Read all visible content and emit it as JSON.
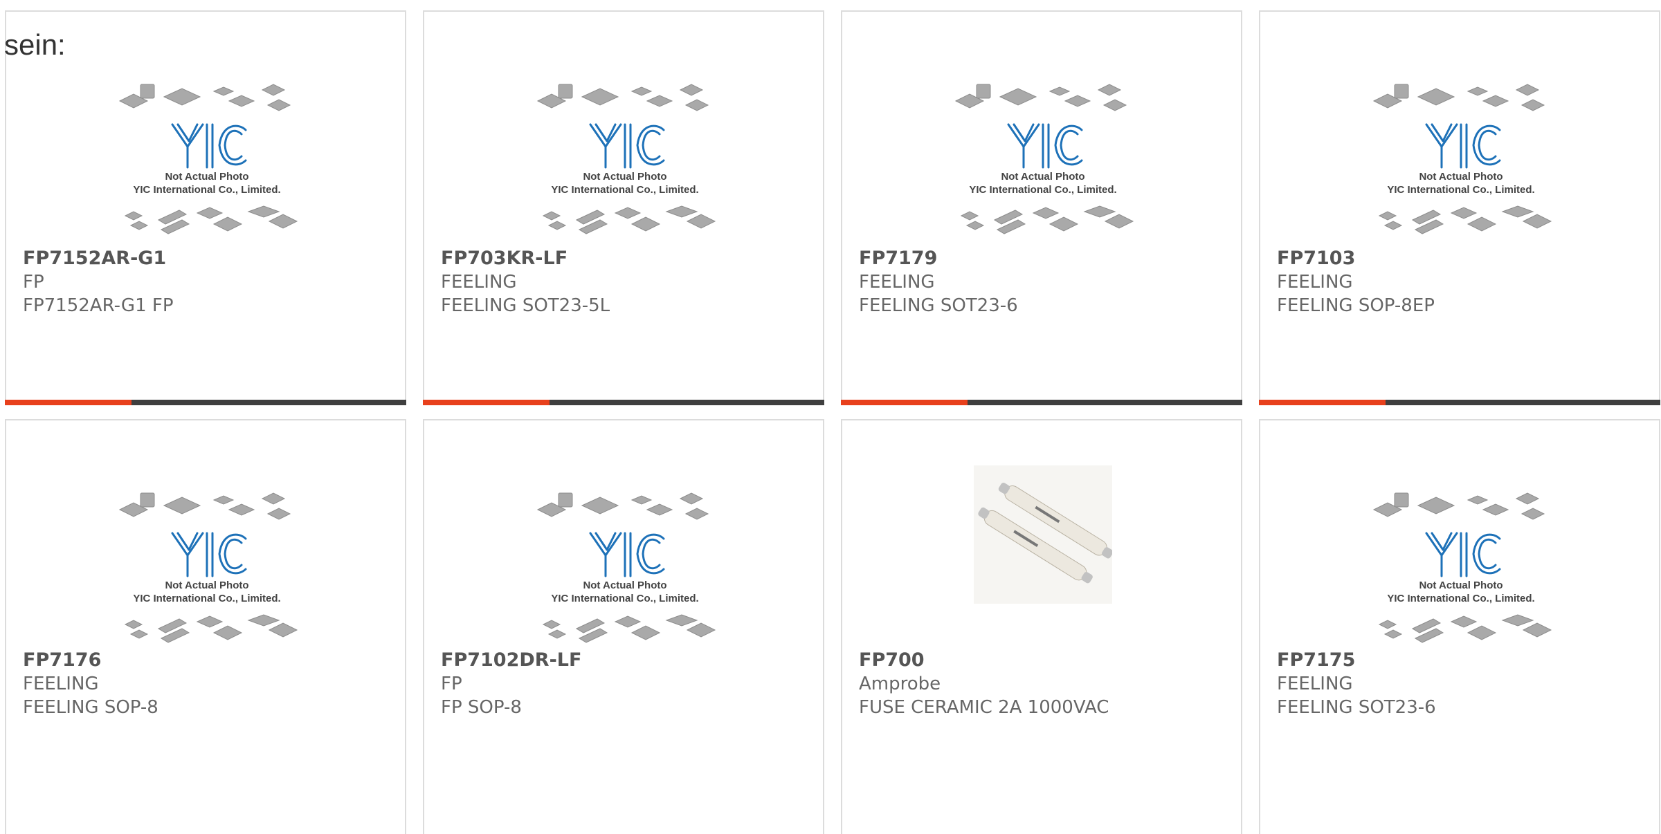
{
  "intro_text": "sein:",
  "colors": {
    "accent": "#e8401c",
    "bar_dark": "#3f3f3f",
    "logo_blue": "#1d71b8"
  },
  "placeholder": {
    "line1": "Not Actual Photo",
    "line2": "YIC International Co., Limited."
  },
  "products": [
    {
      "name": "FP7152AR-G1",
      "brand": "FP",
      "desc": "FP7152AR-G1 FP",
      "image": "placeholder-logo"
    },
    {
      "name": "FP703KR-LF",
      "brand": "FEELING",
      "desc": "FEELING SOT23-5L",
      "image": "placeholder-logo"
    },
    {
      "name": "FP7179",
      "brand": "FEELING",
      "desc": "FEELING SOT23-6",
      "image": "placeholder-logo"
    },
    {
      "name": "FP7103",
      "brand": "FEELING",
      "desc": "FEELING SOP-8EP",
      "image": "placeholder-logo"
    },
    {
      "name": "FP7176",
      "brand": "FEELING",
      "desc": "FEELING SOP-8",
      "image": "placeholder-logo"
    },
    {
      "name": "FP7102DR-LF",
      "brand": "FP",
      "desc": "FP SOP-8",
      "image": "placeholder-logo"
    },
    {
      "name": "FP700",
      "brand": "Amprobe",
      "desc": "FUSE CERAMIC 2A 1000VAC",
      "image": "ceramic-fuse-photo"
    },
    {
      "name": "FP7175",
      "brand": "FEELING",
      "desc": "FEELING SOT23-6",
      "image": "placeholder-logo"
    }
  ]
}
